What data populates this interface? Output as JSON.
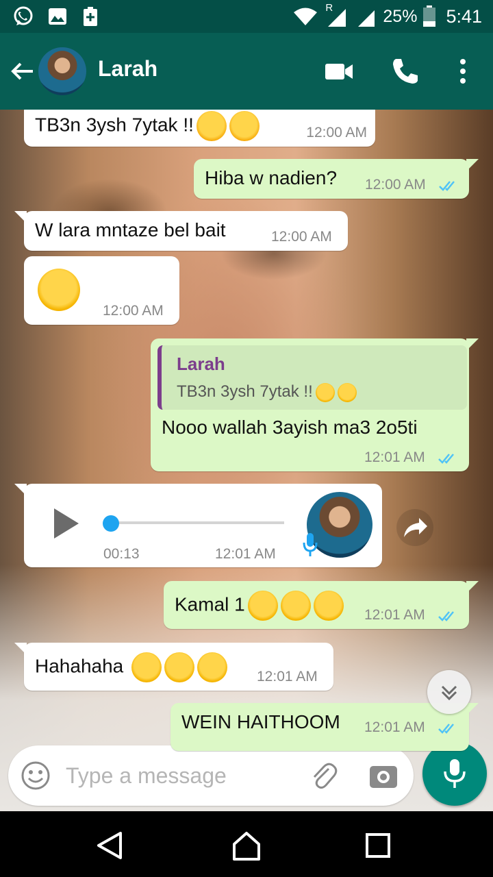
{
  "status_bar": {
    "roaming": "R",
    "battery": "25%",
    "time": "5:41"
  },
  "header": {
    "contact_name": "Larah"
  },
  "messages": [
    {
      "dir": "in",
      "text": "TB3n 3ysh 7ytak !!",
      "emoji": [
        "unamused",
        "unamused"
      ],
      "time": "12:00 AM"
    },
    {
      "dir": "out",
      "text": "Hiba w nadien?",
      "time": "12:00 AM"
    },
    {
      "dir": "in",
      "text": "W lara mntaze bel bait",
      "time": "12:00 AM"
    },
    {
      "dir": "in",
      "text": "",
      "emoji": [
        "joy"
      ],
      "time": "12:00 AM"
    },
    {
      "dir": "out",
      "quote_name": "Larah",
      "quote_text": "TB3n 3ysh 7ytak !!",
      "text": "Nooo wallah 3ayish ma3 2o5ti",
      "time": "12:01 AM"
    },
    {
      "dir": "in",
      "type": "voice",
      "duration": "00:13",
      "progress": 0.0,
      "time": "12:01 AM"
    },
    {
      "dir": "out",
      "text": "Kamal 1",
      "emoji": [
        "joy",
        "joy",
        "joy"
      ],
      "time": "12:01 AM"
    },
    {
      "dir": "in",
      "text": "Hahahaha ",
      "emoji": [
        "joy",
        "joy",
        "joy"
      ],
      "time": "12:01 AM"
    },
    {
      "dir": "out",
      "text": "WEIN HAITHOOM",
      "time": "12:01 AM"
    }
  ],
  "composer": {
    "placeholder": "Type a message"
  },
  "colors": {
    "header": "#075e54",
    "status_bar": "#044f47",
    "outgoing": "#dcf8c6",
    "incoming": "#ffffff",
    "tick_read": "#4fc3f7",
    "accent": "#00897b"
  }
}
